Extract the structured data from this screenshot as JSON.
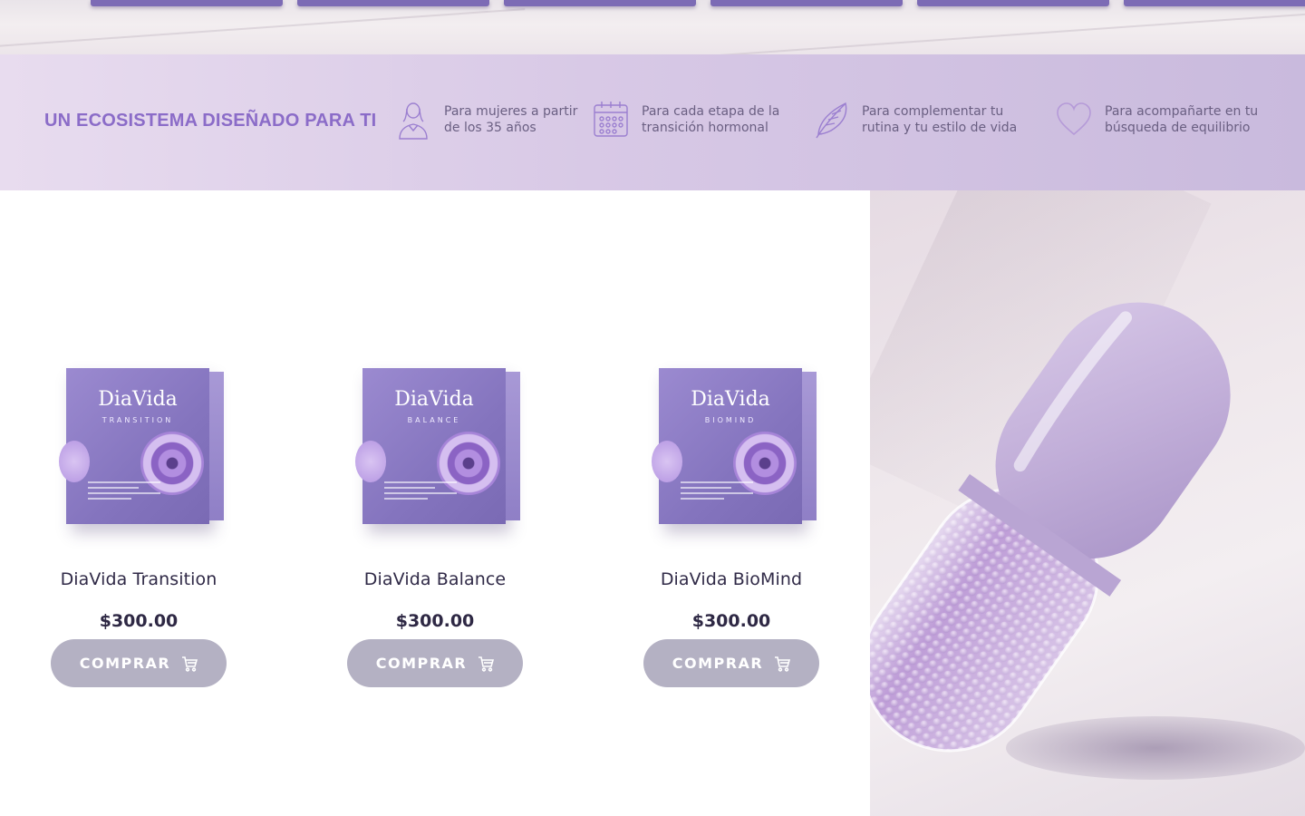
{
  "banner": {
    "title": "UN ECOSISTEMA DISEÑADO PARA TI",
    "features": [
      {
        "icon": "woman-icon",
        "text": "Para mujeres a partir de los 35 años"
      },
      {
        "icon": "calendar-icon",
        "text": "Para cada etapa de la transición hormonal"
      },
      {
        "icon": "feather-icon",
        "text": "Para complementar tu rutina y tu estilo de vida"
      },
      {
        "icon": "heart-icon",
        "text": "Para acompañarte en tu búsqueda de equilibrio"
      }
    ]
  },
  "products": [
    {
      "name": "DiaVida Transition",
      "price": "$300.00",
      "button": "COMPRAR",
      "box_brand": "DiaVida",
      "box_sub": "TRANSITION"
    },
    {
      "name": "DiaVida Balance",
      "price": "$300.00",
      "button": "COMPRAR",
      "box_brand": "DiaVida",
      "box_sub": "BALANCE"
    },
    {
      "name": "DiaVida BioMind",
      "price": "$300.00",
      "button": "COMPRAR",
      "box_brand": "DiaVida",
      "box_sub": "BIOMIND"
    }
  ],
  "colors": {
    "accent": "#8b6cc8",
    "banner_start": "#e8dcef",
    "banner_end": "#c9badd",
    "button": "#b4b1c3",
    "capsule": "#cdb8e0"
  }
}
